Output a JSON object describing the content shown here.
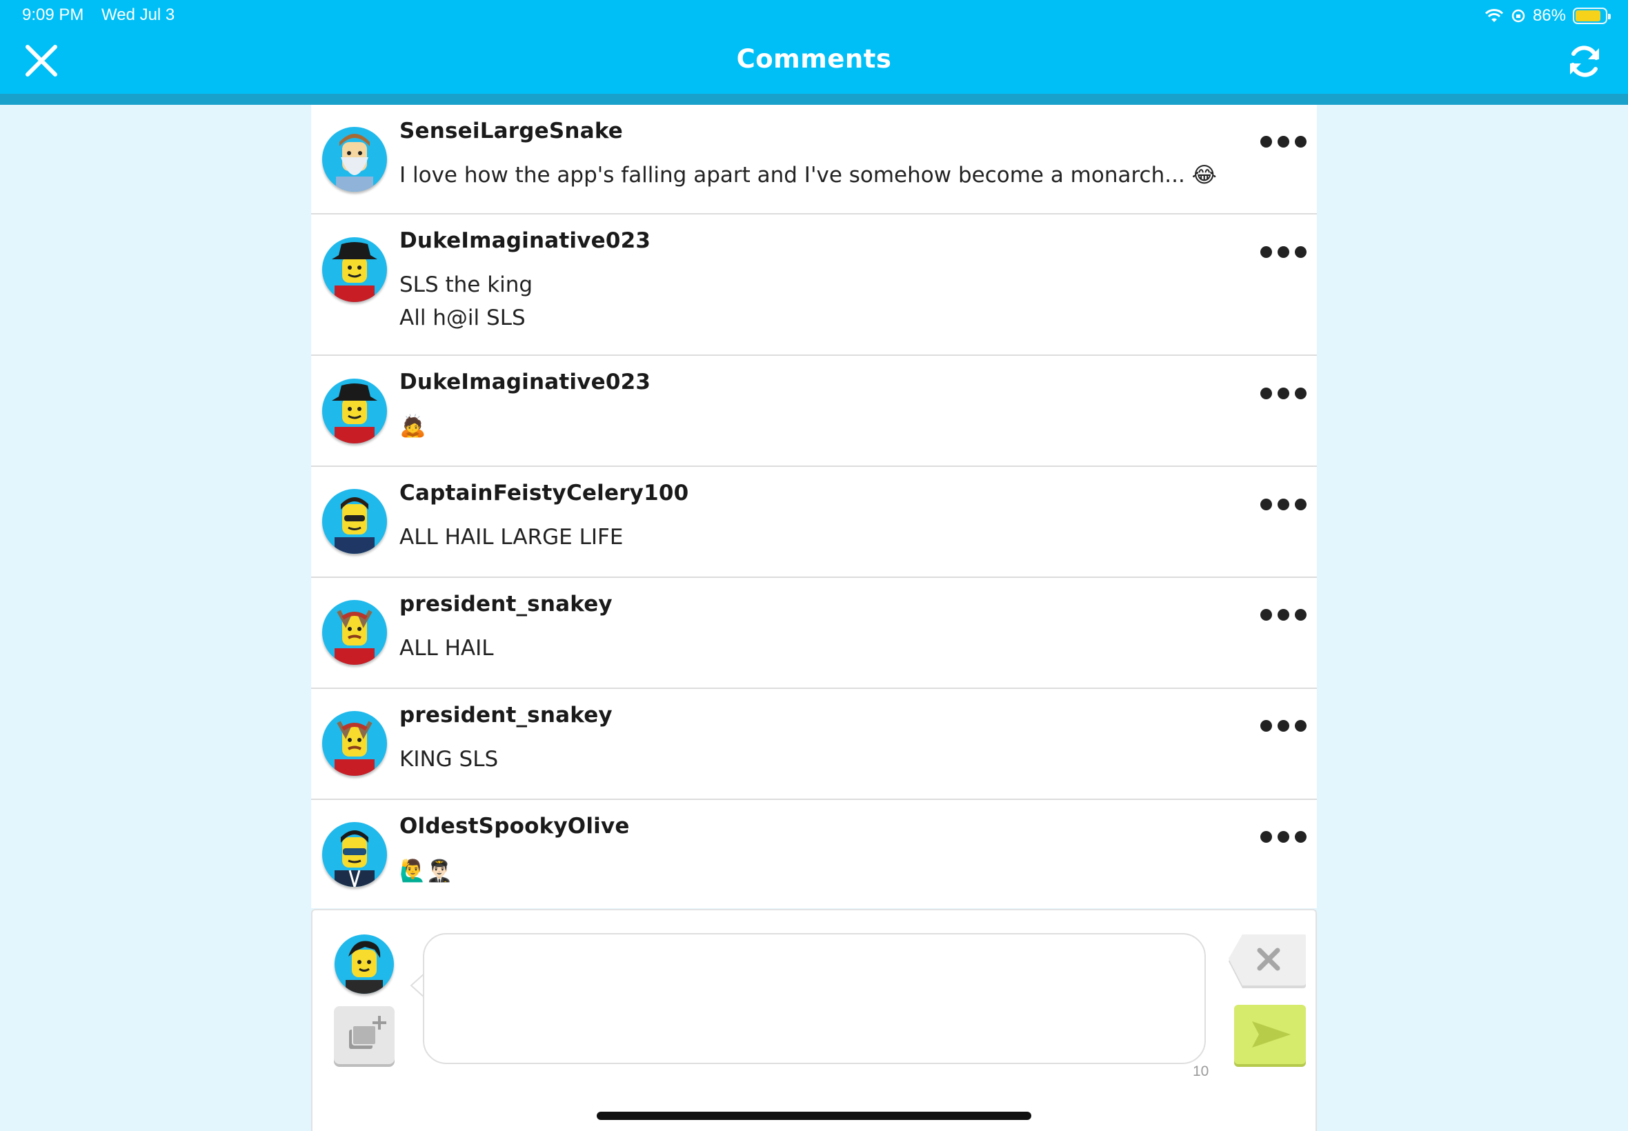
{
  "status_bar": {
    "time": "9:09 PM",
    "date": "Wed Jul 3",
    "battery": "86%",
    "battery_level": 0.86
  },
  "header": {
    "title": "Comments",
    "close_icon": "close-icon",
    "refresh_icon": "refresh-icon",
    "color": "#00bff6"
  },
  "comments": [
    {
      "username": "SenseiLargeSnake",
      "lines": [
        "I love how the app's falling apart and I've somehow become a monarch... 😂"
      ],
      "avatar": "wizard-minifig-icon"
    },
    {
      "username": "DukeImaginative023",
      "lines": [
        "SLS the king",
        "All h@il SLS"
      ],
      "avatar": "cowboy-minifig-icon"
    },
    {
      "username": "DukeImaginative023",
      "lines": [
        "🙇"
      ],
      "avatar": "cowboy-minifig-icon"
    },
    {
      "username": "CaptainFeistyCelery100",
      "lines": [
        "ALL HAIL LARGE LIFE"
      ],
      "avatar": "police-minifig-icon"
    },
    {
      "username": "president_snakey",
      "lines": [
        "ALL HAIL"
      ],
      "avatar": "viking-minifig-icon"
    },
    {
      "username": "president_snakey",
      "lines": [
        "KING SLS"
      ],
      "avatar": "viking-minifig-icon"
    },
    {
      "username": "OldestSpookyOlive",
      "lines": [
        "🙋‍♂️👨🏻‍✈️"
      ],
      "avatar": "masked-minifig-icon"
    }
  ],
  "composer": {
    "placeholder": "",
    "char_counter": "10",
    "send_color": "#d6ea6c"
  }
}
